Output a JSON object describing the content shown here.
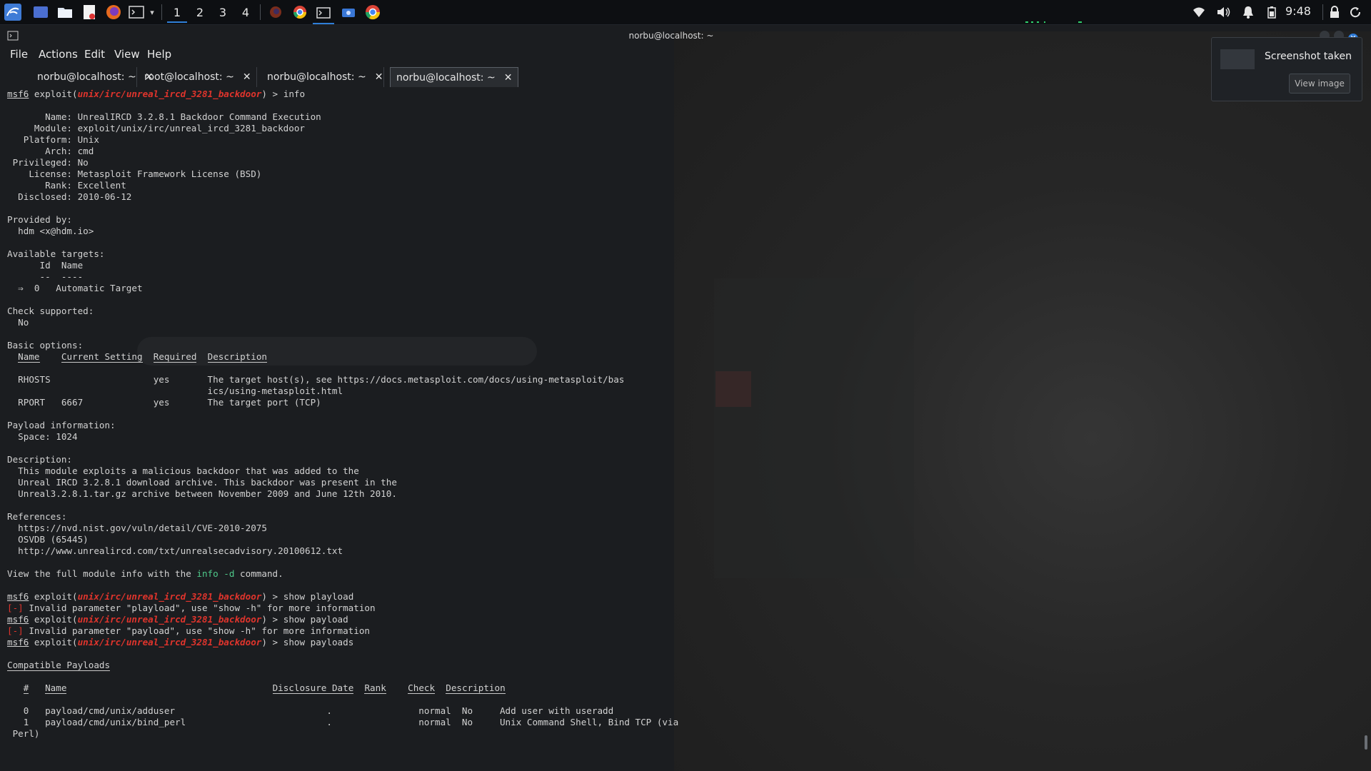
{
  "taskbar": {
    "workspaces": [
      "1",
      "2",
      "3",
      "4"
    ],
    "clock": "9:48"
  },
  "window": {
    "title": "norbu@localhost: ~"
  },
  "menu": [
    "File",
    "Actions",
    "Edit",
    "View",
    "Help"
  ],
  "tabs": [
    {
      "label": "norbu@localhost: ~",
      "active": false
    },
    {
      "label": "root@localhost: ~",
      "active": false
    },
    {
      "label": "norbu@localhost: ~",
      "active": false
    },
    {
      "label": "norbu@localhost: ~",
      "active": true
    }
  ],
  "terminal": {
    "prompt_user": "msf6",
    "prompt_mid": " exploit(",
    "module_path": "unix/irc/unreal_ircd_3281_backdoor",
    "prompt_end": ") > ",
    "cmd_info": "info",
    "info_block": "\n       Name: UnrealIRCD 3.2.8.1 Backdoor Command Execution\n     Module: exploit/unix/irc/unreal_ircd_3281_backdoor\n   Platform: Unix\n       Arch: cmd\n Privileged: No\n    License: Metasploit Framework License (BSD)\n       Rank: Excellent\n  Disclosed: 2010-06-12\n\nProvided by:\n  hdm <x@hdm.io>\n\nAvailable targets:\n      Id  Name\n      --  ----\n  ⇒  0   Automatic Target\n\nCheck supported:\n  No\n\nBasic options:",
    "opt_header": {
      "name": "Name",
      "setting": "Current Setting",
      "required": "Required",
      "description": "Description"
    },
    "opt_rows_text": "\n  RHOSTS                   yes       The target host(s), see https://docs.metasploit.com/docs/using-metasploit/bas\n                                     ics/using-metasploit.html\n  RPORT   6667             yes       The target port (TCP)\n\nPayload information:\n  Space: 1024\n\nDescription:\n  This module exploits a malicious backdoor that was added to the\n  Unreal IRCD 3.2.8.1 download archive. This backdoor was present in the\n  Unreal3.2.8.1.tar.gz archive between November 2009 and June 12th 2010.\n\nReferences:\n  https://nvd.nist.gov/vuln/detail/CVE-2010-2075\n  OSVDB (65445)\n  http://www.unrealircd.com/txt/unrealsecadvisory.20100612.txt\n\n",
    "view_full_pre": "View the full module info with the ",
    "view_full_cmd": "info -d",
    "view_full_post": " command.",
    "cmd_playload": "show playload",
    "err_tag": "[-]",
    "err_playload": " Invalid parameter \"playload\", use \"show -h\" for more information",
    "cmd_payload": "show payload",
    "err_payload": " Invalid parameter \"payload\", use \"show -h\" for more information",
    "cmd_payloads": "show payloads",
    "compat_title": "Compatible Payloads",
    "payload_header": {
      "num": "#",
      "name": "Name",
      "date": "Disclosure Date",
      "rank": "Rank",
      "check": "Check",
      "description": "Description"
    },
    "payload_rows_text": "   0   payload/cmd/unix/adduser                            .                normal  No     Add user with useradd\n   1   payload/cmd/unix/bind_perl                          .                normal  No     Unix Command Shell, Bind TCP (via\n Perl)"
  },
  "notification": {
    "title": "Screenshot taken",
    "button": "View image"
  },
  "colors": {
    "module_red": "#e0342c",
    "command_green": "#4fc98a",
    "accent_blue": "#2f7fd8"
  }
}
